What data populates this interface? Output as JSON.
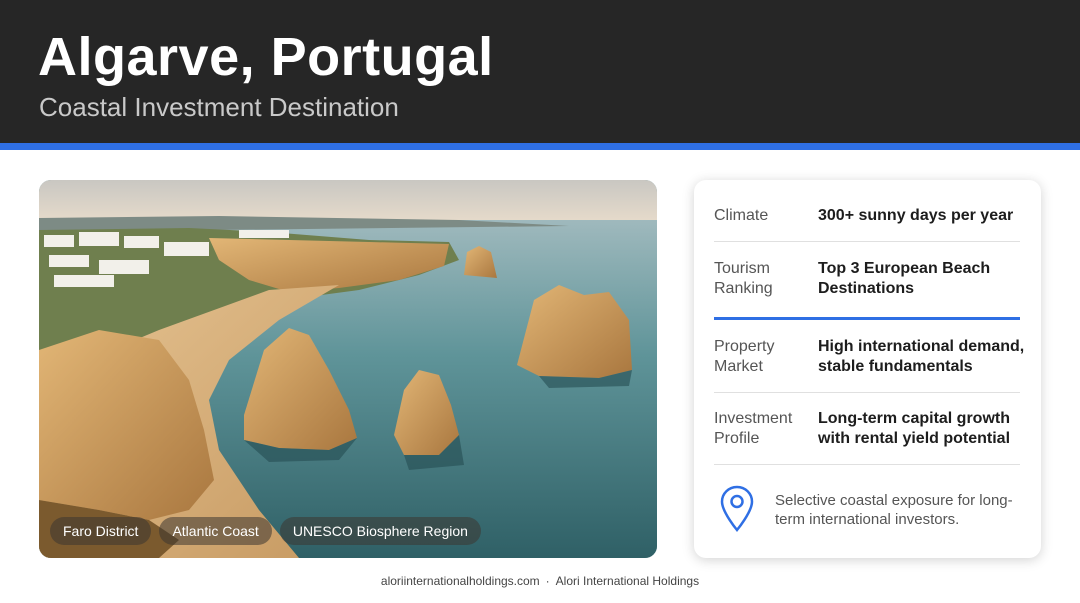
{
  "header": {
    "title": "Algarve, Portugal",
    "subtitle": "Coastal Investment Destination"
  },
  "photo": {
    "tags": [
      "Faro District",
      "Atlantic Coast",
      "UNESCO Biosphere Region"
    ]
  },
  "details": [
    {
      "label": "Climate",
      "value": "300+ sunny days per year"
    },
    {
      "label": "Tourism Ranking",
      "value": "Top 3 European Beach Destinations"
    },
    {
      "label": "Property Market",
      "value": "High international demand, stable fundamentals"
    },
    {
      "label": "Investment Profile",
      "value": "Long-term capital growth with rental yield potential"
    }
  ],
  "note": {
    "icon": "map-pin-icon",
    "text": "Selective coastal exposure for long-term international investors."
  },
  "footer": {
    "website": "aloriinternationalholdings.com",
    "separator": "·",
    "company": "Alori International Holdings"
  },
  "colors": {
    "header_bg": "#262626",
    "accent": "#2f6fe4",
    "text_dark": "#1d1d1d",
    "text_muted": "#555555"
  }
}
